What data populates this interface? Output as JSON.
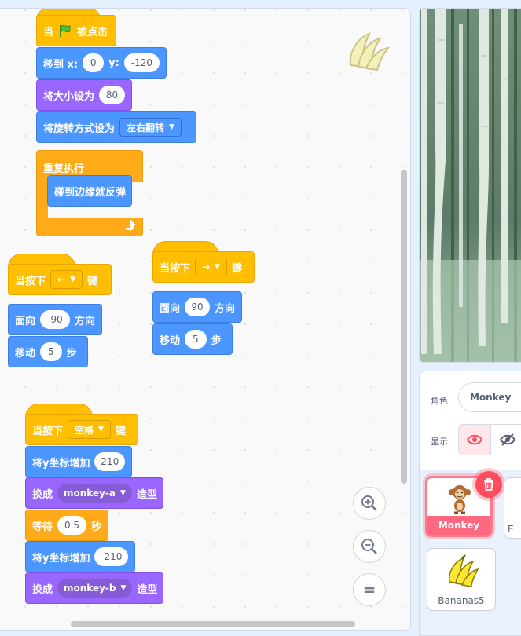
{
  "scripts": {
    "flag_script": {
      "hat_prefix": "当",
      "hat_suffix": "被点击",
      "goto_label": "移到 x:",
      "goto_x": "0",
      "goto_y_label": "y:",
      "goto_y": "-120",
      "size_label": "将大小设为",
      "size_value": "80",
      "rotation_label": "将旋转方式设为",
      "rotation_value": "左右翻转",
      "repeat_label": "重复执行",
      "bounce_label": "碰到边缘就反弹"
    },
    "left_script": {
      "hat_label": "当按下",
      "key": "←",
      "key_suffix": "键",
      "point_label": "面向",
      "point_value": "-90",
      "point_suffix": "方向",
      "move_label": "移动",
      "move_value": "5",
      "move_suffix": "步"
    },
    "right_script": {
      "hat_label": "当按下",
      "key": "→",
      "key_suffix": "键",
      "point_label": "面向",
      "point_value": "90",
      "point_suffix": "方向",
      "move_label": "移动",
      "move_value": "5",
      "move_suffix": "步"
    },
    "space_script": {
      "hat_label": "当按下",
      "key": "空格",
      "key_suffix": "键",
      "change_y_label": "将y坐标增加",
      "change_y_value": "210",
      "costume_label": "换成",
      "costume_value": "monkey-a",
      "costume_suffix": "造型",
      "wait_label": "等待",
      "wait_value": "0.5",
      "wait_suffix": "秒",
      "change_y2_label": "将y坐标增加",
      "change_y2_value": "-210",
      "costume2_label": "换成",
      "costume2_value": "monkey-b",
      "costume2_suffix": "造型"
    }
  },
  "zoom": {
    "in": "+",
    "out": "−",
    "reset": "="
  },
  "sprite_info": {
    "sprite_label": "角色",
    "sprite_name": "Monkey",
    "show_label": "显示"
  },
  "sprites": [
    {
      "name": "Monkey",
      "selected": true,
      "icon": "monkey-icon"
    },
    {
      "name": "Bananas5",
      "selected": false,
      "icon": "bananas-icon"
    }
  ],
  "colors": {
    "events": "#ffbf00",
    "motion": "#4c97ff",
    "looks": "#9966ff",
    "control": "#ffab19",
    "selected_sprite": "#ff6680"
  }
}
